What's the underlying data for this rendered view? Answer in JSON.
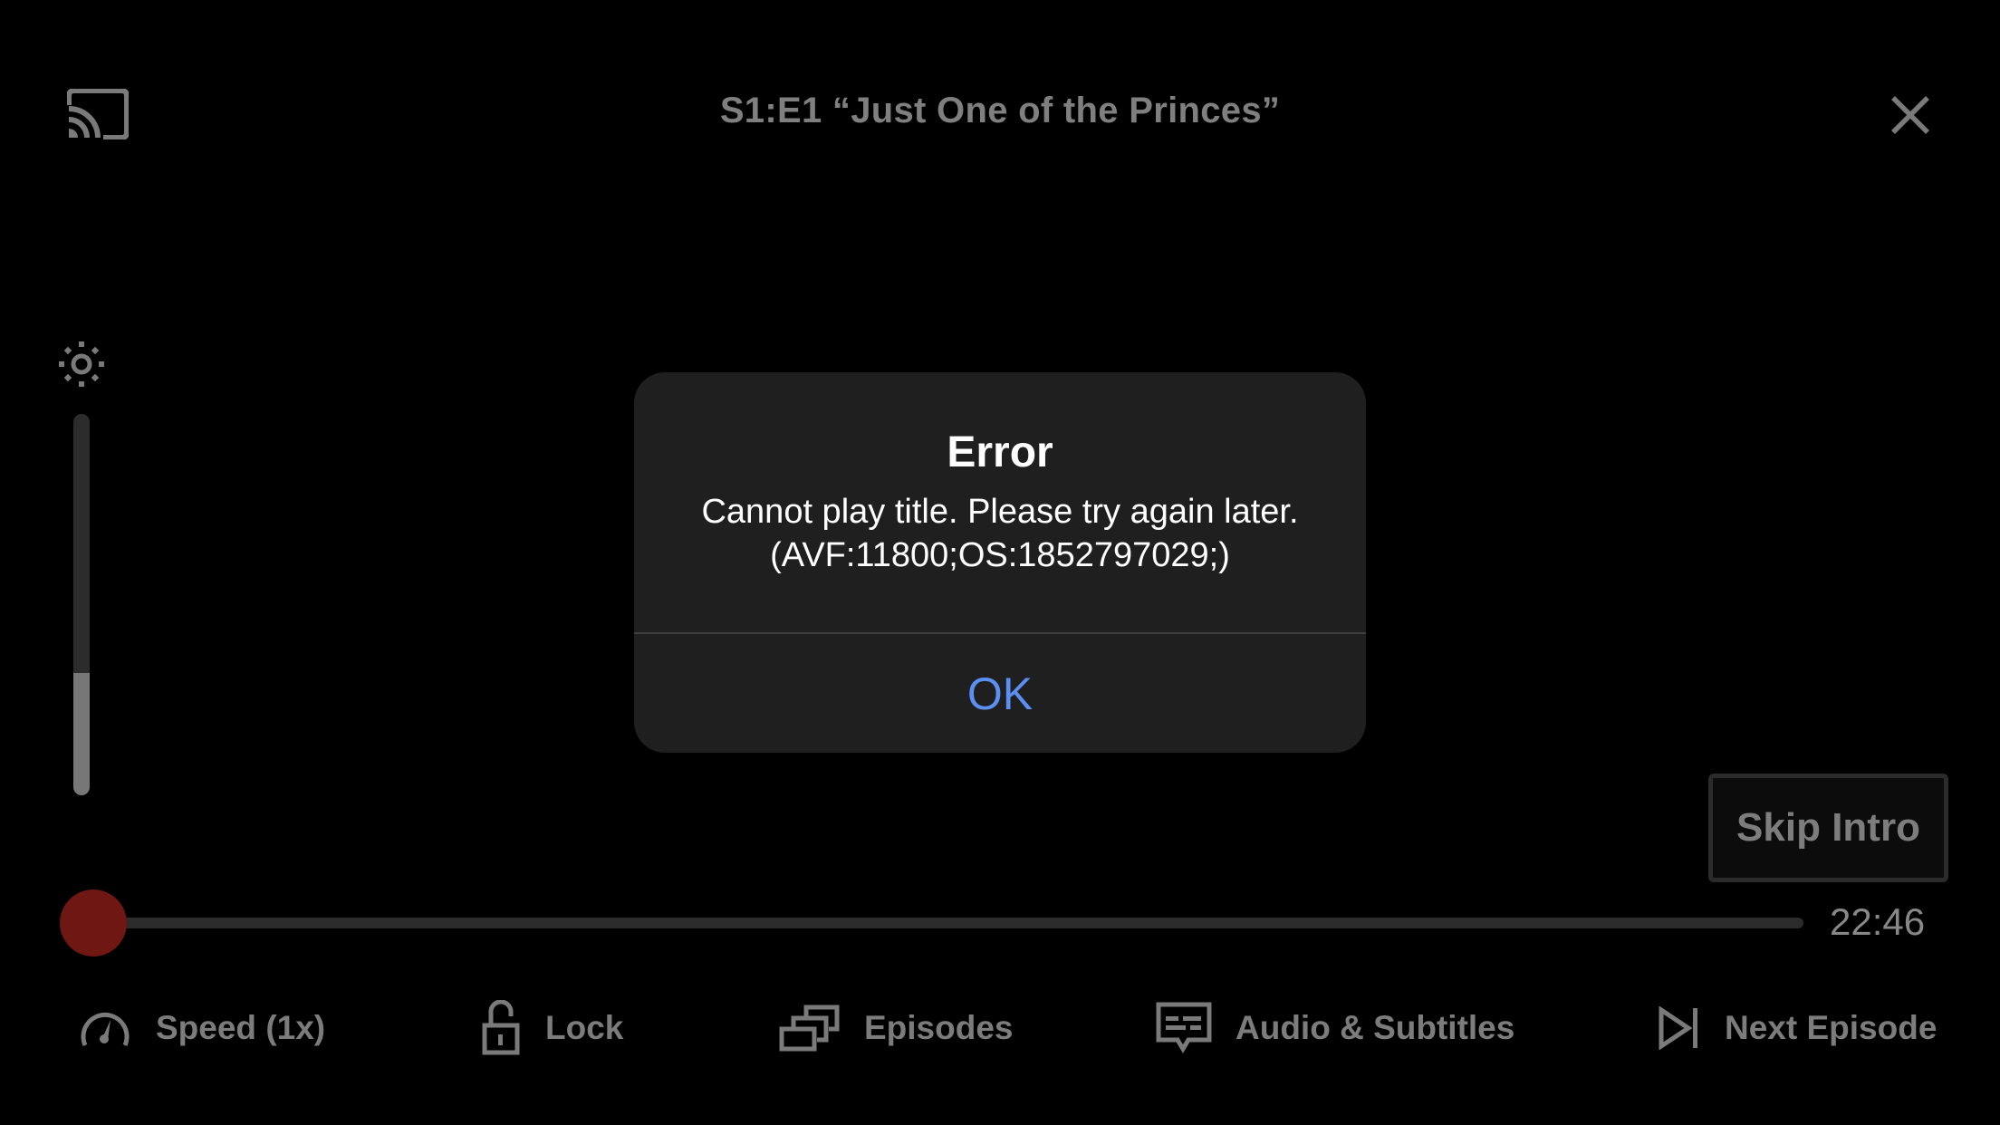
{
  "header": {
    "cast_icon": "cast-icon",
    "title": "S1:E1 “Just One of the Princes”",
    "close_icon": "close-icon"
  },
  "brightness": {
    "icon": "brightness-sun-icon",
    "level_percent": 32
  },
  "dialog": {
    "title": "Error",
    "message_line1": "Cannot play title. Please try again later.",
    "message_line2": "(AVF:11800;OS:1852797029;)",
    "ok_label": "OK",
    "ok_color": "#5b8ff2"
  },
  "skip_intro": {
    "label": "Skip Intro"
  },
  "progress": {
    "played_percent": 0,
    "remaining_time": "22:46",
    "scrubber_color": "#6e1713"
  },
  "controls": [
    {
      "icon": "speedometer-icon",
      "label": "Speed (1x)"
    },
    {
      "icon": "unlock-icon",
      "label": "Lock"
    },
    {
      "icon": "episodes-icon",
      "label": "Episodes"
    },
    {
      "icon": "subtitles-icon",
      "label": "Audio & Subtitles"
    },
    {
      "icon": "next-episode-icon",
      "label": "Next Episode"
    }
  ]
}
